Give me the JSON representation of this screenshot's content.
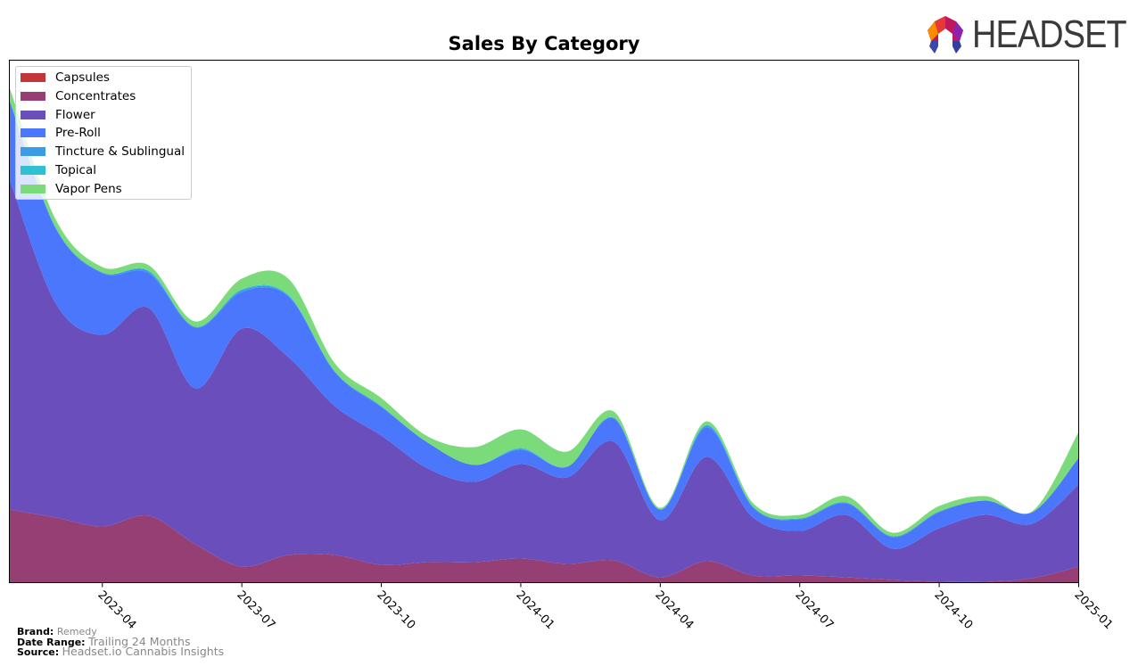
{
  "header": {
    "logo_text": "HEADSET"
  },
  "footer": {
    "brand_label": "Brand:",
    "brand_value": "Remedy",
    "date_range_label": "Date Range:",
    "date_range_value": "Trailing 24 Months",
    "source_label": "Source:",
    "source_value": "Headset.io Cannabis Insights"
  },
  "chart_data": {
    "type": "area",
    "stacked": true,
    "title": "Sales By Category",
    "xlabel": "",
    "ylabel": "",
    "grid": false,
    "legend_position": "top-left",
    "units": "relative sales (no y-axis shown)",
    "x": [
      "2023-02",
      "2023-03",
      "2023-04",
      "2023-05",
      "2023-06",
      "2023-07",
      "2023-08",
      "2023-09",
      "2023-10",
      "2023-11",
      "2023-12",
      "2024-01",
      "2024-02",
      "2024-03",
      "2024-04",
      "2024-05",
      "2024-06",
      "2024-07",
      "2024-08",
      "2024-09",
      "2024-10",
      "2024-11",
      "2024-12",
      "2025-01"
    ],
    "xticks": [
      "2023-04",
      "2023-07",
      "2023-10",
      "2024-01",
      "2024-04",
      "2024-07",
      "2024-10",
      "2025-01"
    ],
    "ylim": [
      0,
      586
    ],
    "series": [
      {
        "name": "Capsules",
        "color": "#c23539",
        "values": [
          0,
          0,
          0,
          0,
          0,
          0,
          0,
          0,
          0,
          0,
          0,
          0,
          0,
          0,
          0,
          0,
          0,
          0,
          0,
          0,
          0,
          0,
          0,
          0
        ]
      },
      {
        "name": "Concentrates",
        "color": "#953f74",
        "values": [
          82,
          73,
          63,
          75,
          43,
          18,
          31,
          31,
          20,
          23,
          23,
          27,
          21,
          25,
          6,
          24,
          8,
          8,
          6,
          3,
          1,
          1,
          5,
          18
        ]
      },
      {
        "name": "Flower",
        "color": "#6a4fbc",
        "values": [
          371,
          240,
          215,
          233,
          175,
          267,
          222,
          167,
          145,
          105,
          90,
          106,
          97,
          133,
          64,
          117,
          65,
          50,
          70,
          35,
          60,
          75,
          61,
          92
        ]
      },
      {
        "name": "Pre-Roll",
        "color": "#4a77fb",
        "values": [
          88,
          84,
          69,
          39,
          68,
          41,
          68,
          38,
          32,
          29,
          19,
          16,
          12,
          26,
          12,
          33,
          11,
          13,
          13,
          13,
          18,
          16,
          13,
          30
        ]
      },
      {
        "name": "Tincture & Sublingual",
        "color": "#3a9be6",
        "values": [
          1,
          1,
          1,
          2,
          1,
          2,
          1,
          1,
          1,
          0,
          0,
          1,
          0,
          1,
          0,
          2,
          1,
          1,
          1,
          1,
          1,
          0,
          0,
          0
        ]
      },
      {
        "name": "Topical",
        "color": "#30c0d4",
        "values": [
          0,
          0,
          0,
          1,
          0,
          1,
          1,
          0,
          0,
          0,
          0,
          1,
          0,
          0,
          0,
          1,
          0,
          0,
          0,
          0,
          0,
          0,
          0,
          0
        ]
      },
      {
        "name": "Vapor Pens",
        "color": "#7bdb7b",
        "values": [
          14,
          9,
          6,
          6,
          6,
          12,
          18,
          9,
          9,
          7,
          20,
          21,
          17,
          7,
          2,
          4,
          4,
          4,
          7,
          4,
          6,
          5,
          1,
          29
        ]
      }
    ]
  }
}
